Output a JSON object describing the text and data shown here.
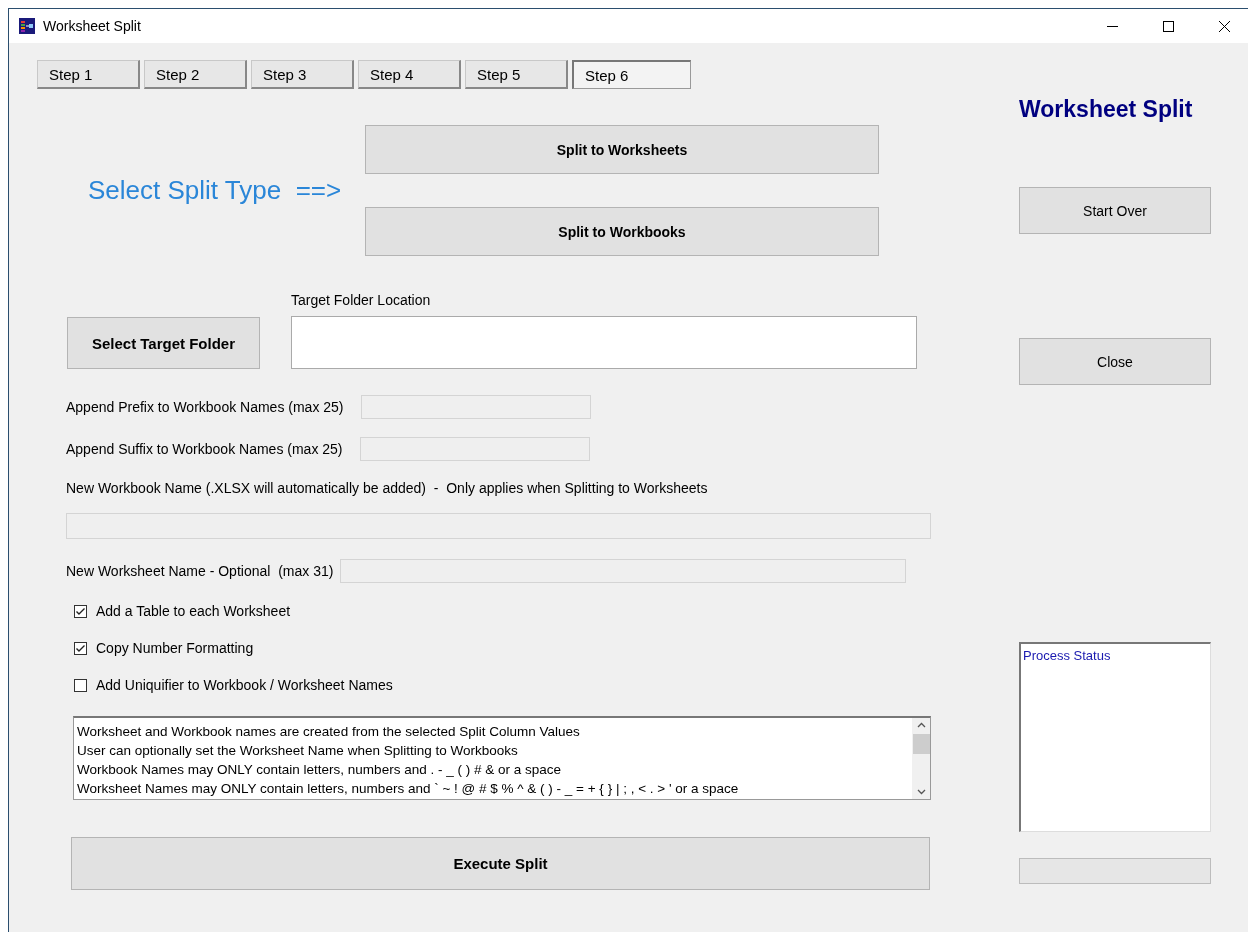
{
  "window": {
    "title": "Worksheet Split"
  },
  "tabs": [
    {
      "label": "Step 1",
      "selected": false
    },
    {
      "label": "Step 2",
      "selected": false
    },
    {
      "label": "Step 3",
      "selected": false
    },
    {
      "label": "Step 4",
      "selected": false
    },
    {
      "label": "Step 5",
      "selected": false
    },
    {
      "label": "Step 6",
      "selected": true
    }
  ],
  "split_type": {
    "prompt": "Select Split Type  ==>",
    "buttons": [
      "Split to Worksheets",
      "Split to Workbooks"
    ]
  },
  "target": {
    "button": "Select Target Folder",
    "label": "Target Folder Location"
  },
  "prefix": {
    "label": "Append Prefix to Workbook Names (max 25)"
  },
  "suffix": {
    "label": "Append Suffix to Workbook Names (max 25)"
  },
  "workbook_name": {
    "label": "New Workbook Name (.XLSX will automatically be added)  -  Only applies when Splitting to Worksheets"
  },
  "worksheet_name": {
    "label": "New Worksheet Name - Optional  (max 31)"
  },
  "options": [
    {
      "label": "Add a Table to each Worksheet",
      "checked": true
    },
    {
      "label": "Copy Number Formatting",
      "checked": true
    },
    {
      "label": "Add Uniquifier to Workbook / Worksheet Names",
      "checked": false
    }
  ],
  "notes": [
    "Worksheet and Workbook names are created from the selected Split Column Values",
    "User can optionally set the Worksheet Name when Splitting to Workbooks",
    "Workbook Names may ONLY contain letters, numbers and . - _  ( ) # & or a space",
    "Worksheet Names may ONLY contain letters, numbers and ` ~ ! @ # $ % ^ & ( ) - _ = + { } | ; , < . > ' or a space"
  ],
  "execute_button": "Execute Split",
  "sidebar": {
    "title": "Worksheet Split",
    "buttons": [
      "Start Over",
      "Close"
    ],
    "status_title": "Process Status",
    "progress": {
      "level": 0
    }
  }
}
